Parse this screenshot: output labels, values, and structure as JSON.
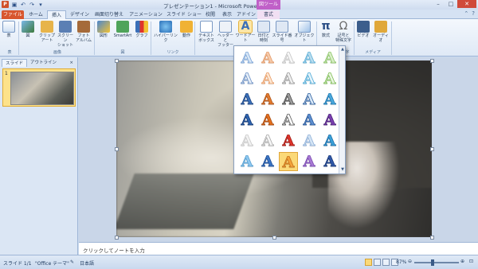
{
  "window": {
    "title": "プレゼンテーション1 - Microsoft PowerPoint",
    "app_icon": "P",
    "context_tab_header": "図ツール"
  },
  "tabs": [
    "ファイル",
    "ホーム",
    "挿入",
    "デザイン",
    "画面切り替え",
    "アニメーション",
    "スライド ショー",
    "校閲",
    "表示",
    "アドイン",
    "書式"
  ],
  "ribbon": {
    "buttons": [
      "表",
      "図",
      "クリップ\nアート",
      "スクリーン\nショット",
      "フォト\nアルバム",
      "図形",
      "SmartArt",
      "グラフ",
      "ハイパーリンク",
      "動作",
      "テキスト\nボックス",
      "ヘッダーと\nフッター",
      "ワードアート",
      "日付と\n時刻",
      "スライド番号",
      "オブジェクト",
      "数式",
      "記号と\n特殊文字",
      "ビデオ",
      "オーディオ"
    ],
    "groups": [
      "表",
      "画像",
      "図",
      "リンク",
      "テキスト",
      "記号と特殊文字",
      "メディア"
    ]
  },
  "left_panel": {
    "tabs": [
      "スライド",
      "アウトライン"
    ],
    "close": "×",
    "slide_number": "1"
  },
  "notes_placeholder": "クリックしてノートを入力",
  "status": {
    "slide": "スライド 1/1",
    "theme": "\"Office テーマ\"",
    "language": "日本語",
    "zoom": "87%",
    "zoom_minus": "⊖",
    "zoom_plus": "⊕"
  },
  "wordart_gallery": {
    "glyph": "A",
    "selected_index": 27,
    "styles": [
      {
        "fill": "#d7e6f6",
        "stroke": "#7aa4d8"
      },
      {
        "fill": "#f6c9a8",
        "stroke": "#e39b6a"
      },
      {
        "fill": "#f8f8f8",
        "stroke": "#c4c4c4"
      },
      {
        "fill": "#b8dcee",
        "stroke": "#5fb0d8"
      },
      {
        "fill": "#d8eec6",
        "stroke": "#8dc56a"
      },
      {
        "fill": "#e6eef8",
        "stroke": "#6a8fc4"
      },
      {
        "fill": "#fde7d3",
        "stroke": "#e89a62"
      },
      {
        "fill": "#f0f0f0",
        "stroke": "#9a9a9a"
      },
      {
        "fill": "#e6f4fb",
        "stroke": "#4aa8d6"
      },
      {
        "fill": "#eaf6e0",
        "stroke": "#7dbd54"
      },
      {
        "fill": "#3a6fb8",
        "stroke": "#1e4785"
      },
      {
        "fill": "#e27a2e",
        "stroke": "#b0561a"
      },
      {
        "fill": "#9c9c9c",
        "stroke": "#4a4a4a"
      },
      {
        "fill": "#d8e8f8",
        "stroke": "#2a5c9c"
      },
      {
        "fill": "#4aa8dc",
        "stroke": "#1f78b0"
      },
      {
        "fill": "#2e64b0",
        "stroke": "#163c78"
      },
      {
        "fill": "#e4701e",
        "stroke": "#a84a10"
      },
      {
        "fill": "#ffffff",
        "stroke": "#555555"
      },
      {
        "fill": "#5d8fd0",
        "stroke": "#2b5a9a"
      },
      {
        "fill": "#7a3fb0",
        "stroke": "#4b1f78"
      },
      {
        "fill": "#f2f2f2",
        "stroke": "#c8c8c8"
      },
      {
        "fill": "#f6f6f6",
        "stroke": "#a8a8a8"
      },
      {
        "fill": "#e0342a",
        "stroke": "#a01a14"
      },
      {
        "fill": "#d4e4f4",
        "stroke": "#8fb0d8"
      },
      {
        "fill": "#3aa0d8",
        "stroke": "#1d6fa8"
      },
      {
        "fill": "#8ec8f0",
        "stroke": "#5aa0d0"
      },
      {
        "fill": "#3a74c4",
        "stroke": "#1f4f96"
      },
      {
        "fill": "#f4a23a",
        "stroke": "#c4701a"
      },
      {
        "fill": "#a87ad4",
        "stroke": "#7a4ab0"
      },
      {
        "fill": "#2f58a8",
        "stroke": "#1a3878"
      }
    ]
  }
}
